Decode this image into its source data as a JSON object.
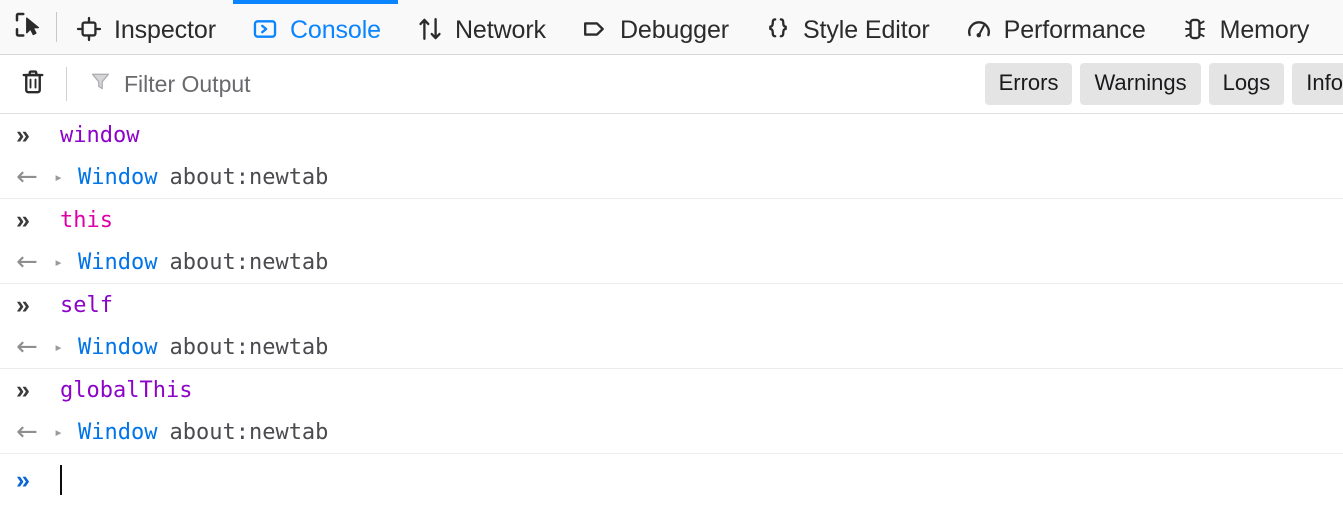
{
  "toolbar": {
    "picker_icon": "element-picker-icon",
    "tabs": [
      {
        "label": "Inspector",
        "icon": "inspector-icon",
        "active": false
      },
      {
        "label": "Console",
        "icon": "console-icon",
        "active": true
      },
      {
        "label": "Network",
        "icon": "network-icon",
        "active": false
      },
      {
        "label": "Debugger",
        "icon": "debugger-icon",
        "active": false
      },
      {
        "label": "Style Editor",
        "icon": "style-editor-icon",
        "active": false
      },
      {
        "label": "Performance",
        "icon": "performance-icon",
        "active": false
      },
      {
        "label": "Memory",
        "icon": "memory-icon",
        "active": false
      }
    ]
  },
  "filterbar": {
    "clear_icon": "trash-icon",
    "filter_icon": "funnel-icon",
    "filter_placeholder": "Filter Output",
    "filter_value": "",
    "buttons": [
      {
        "label": "Errors"
      },
      {
        "label": "Warnings"
      },
      {
        "label": "Logs"
      },
      {
        "label": "Info"
      }
    ]
  },
  "console": {
    "prompt_glyph": "»",
    "return_glyph": "←",
    "expand_glyph": "▸",
    "entries": [
      {
        "expression": "window",
        "expression_kind": "purple",
        "result_type": "Window",
        "result_value": "about:newtab"
      },
      {
        "expression": "this",
        "expression_kind": "magenta",
        "result_type": "Window",
        "result_value": "about:newtab"
      },
      {
        "expression": "self",
        "expression_kind": "purple",
        "result_type": "Window",
        "result_value": "about:newtab"
      },
      {
        "expression": "globalThis",
        "expression_kind": "purple",
        "result_type": "Window",
        "result_value": "about:newtab"
      }
    ],
    "input_prompt_glyph": "»",
    "input_value": ""
  },
  "colors": {
    "accent": "#0a84ff",
    "expr_purple": "#8c04c8",
    "expr_magenta": "#dd00a9",
    "object_blue": "#0074e8",
    "toolbar_bg": "#f9f9fa"
  }
}
